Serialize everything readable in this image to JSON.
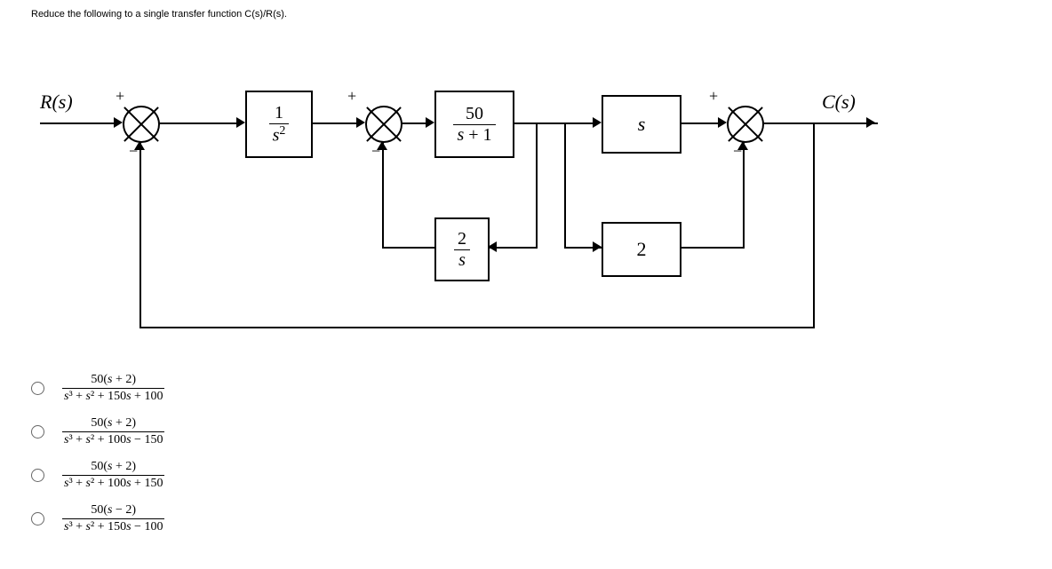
{
  "prompt": "Reduce the following to a single transfer function C(s)/R(s).",
  "diagram": {
    "input_label": "R(s)",
    "output_label": "C(s)",
    "block1_num": "1",
    "block1_den_base": "s",
    "block1_den_exp": "2",
    "block2_num": "50",
    "block2_den": "s + 1",
    "block3": "s",
    "feedback_inner_num": "2",
    "feedback_inner_den": "s",
    "feedback_gain": "2",
    "sum1": {
      "top": "+",
      "bottom": "−"
    },
    "sum2": {
      "top": "+",
      "bottom": "−"
    },
    "sum3": {
      "top": "+",
      "bottom": "−"
    }
  },
  "options": [
    {
      "num": "50(s + 2)",
      "den": "s³ + s² + 150s + 100"
    },
    {
      "num": "50(s + 2)",
      "den": "s³ + s² + 100s − 150"
    },
    {
      "num": "50(s + 2)",
      "den": "s³ + s² + 100s + 150"
    },
    {
      "num": "50(s − 2)",
      "den": "s³ + s² + 150s − 100"
    }
  ]
}
